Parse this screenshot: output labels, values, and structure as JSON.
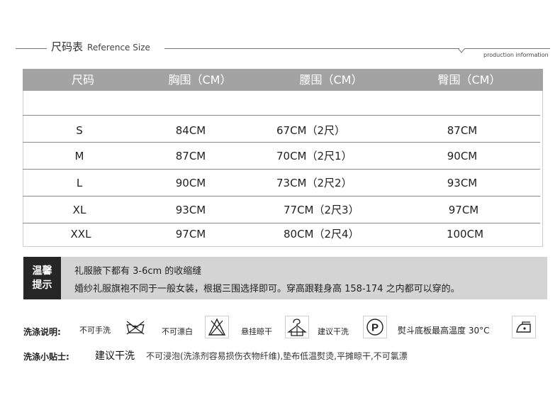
{
  "header": {
    "title_cn": "尺码表",
    "title_en": "Reference Size",
    "production_info": "production information"
  },
  "table": {
    "headers": [
      "尺码",
      "胸围（CM）",
      "腰围（CM）",
      "臀围（CM）"
    ],
    "rows": [
      [
        "S",
        "84CM",
        "67CM（2尺）",
        "87CM"
      ],
      [
        "M",
        "87CM",
        "70CM（2尺1）",
        "90CM"
      ],
      [
        "L",
        "90CM",
        "73CM（2尺2）",
        "93CM"
      ],
      [
        "XL",
        "93CM",
        "77CM（2尺3）",
        "97CM"
      ],
      [
        "XXL",
        "97CM",
        "80CM（2尺4）",
        "100CM"
      ]
    ]
  },
  "tip": {
    "label_line1": "温馨",
    "label_line2": "提示",
    "line1": "礼服腋下都有 3-6cm 的收缩缝",
    "line2": "婚纱礼服旗袍不同于一般女装，根据三围选择即可。穿高跟鞋身高 158-174 之内都可以穿的。"
  },
  "care": {
    "heading": "洗涤说明:",
    "items": [
      {
        "text": "不可手洗",
        "icon": "no-hand-wash-icon"
      },
      {
        "text": "不可漂白",
        "icon": "no-bleach-icon"
      },
      {
        "text": "悬挂晾干",
        "icon": "hang-dry-icon"
      },
      {
        "text": "建议干洗",
        "icon": "dry-clean-p-icon"
      },
      {
        "text": "熨斗底板最高温度 30°C",
        "icon": "iron-icon"
      }
    ]
  },
  "tips": {
    "heading": "洗涤小贴士:",
    "main": "建议干洗",
    "rest": "不可浸泡(洗涤剂容易损伤衣物纤维),垫布低温熨烫,平摊晾干,不可氯漂"
  }
}
